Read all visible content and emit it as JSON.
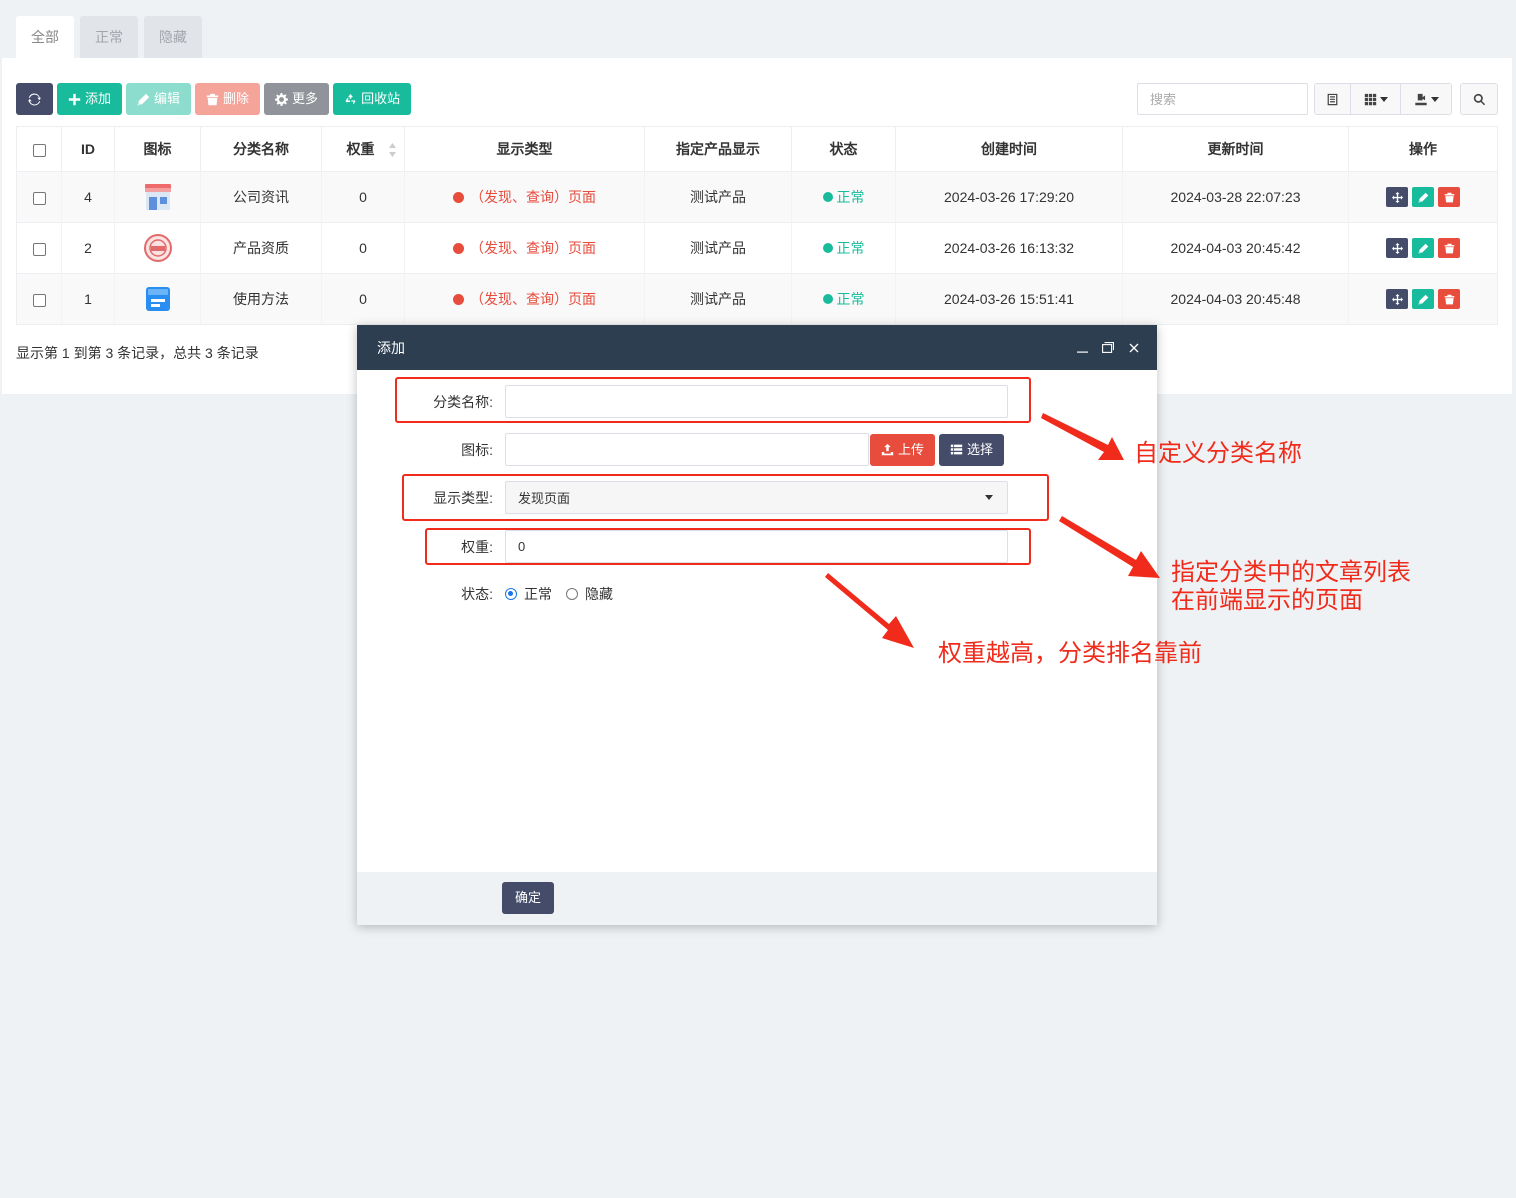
{
  "tabs": [
    {
      "label": "全部"
    },
    {
      "label": "正常"
    },
    {
      "label": "隐藏"
    }
  ],
  "toolbar": {
    "add_label": "添加",
    "edit_label": "编辑",
    "delete_label": "删除",
    "more_label": "更多",
    "recycle_label": "回收站",
    "search_placeholder": "搜索"
  },
  "table": {
    "headers": [
      "ID",
      "图标",
      "分类名称",
      "权重",
      "显示类型",
      "指定产品显示",
      "状态",
      "创建时间",
      "更新时间",
      "操作"
    ],
    "rows": [
      {
        "id": "4",
        "icon": "shop-icon",
        "name": "公司资讯",
        "weight": "0",
        "display_type": "（发现、查询）页面",
        "product": "测试产品",
        "status": "正常",
        "created": "2024-03-26 17:29:20",
        "updated": "2024-03-28 22:07:23"
      },
      {
        "id": "2",
        "icon": "stamp-seal-icon",
        "name": "产品资质",
        "weight": "0",
        "display_type": "（发现、查询）页面",
        "product": "测试产品",
        "status": "正常",
        "created": "2024-03-26 16:13:32",
        "updated": "2024-04-03 20:45:42"
      },
      {
        "id": "1",
        "icon": "document-card-icon",
        "name": "使用方法",
        "weight": "0",
        "display_type": "（发现、查询）页面",
        "product": "测试产品",
        "status": "正常",
        "created": "2024-03-26 15:51:41",
        "updated": "2024-04-03 20:45:48"
      }
    ],
    "footer": "显示第 1 到第 3 条记录，总共 3 条记录"
  },
  "modal": {
    "title": "添加",
    "name_label": "分类名称:",
    "name_value": "",
    "icon_label": "图标:",
    "icon_value": "",
    "upload_label": "上传",
    "choose_label": "选择",
    "display_type_label": "显示类型:",
    "display_type_value": "发现页面",
    "weight_label": "权重:",
    "weight_value": "0",
    "status_label": "状态:",
    "status_options": [
      "正常",
      "隐藏"
    ],
    "status_selected": "正常",
    "ok_label": "确定"
  },
  "annotations": {
    "name_note": "自定义分类名称",
    "display_note_line1": "指定分类中的文章列表",
    "display_note_line2": "在前端显示的页面",
    "weight_note": "权重越高，分类排名靠前"
  },
  "colors": {
    "accent_dark": "#444c69",
    "success": "#18bc9c",
    "danger": "#e74c3c",
    "annotation": "#f02b1b",
    "modal_header": "#2c3e50"
  }
}
